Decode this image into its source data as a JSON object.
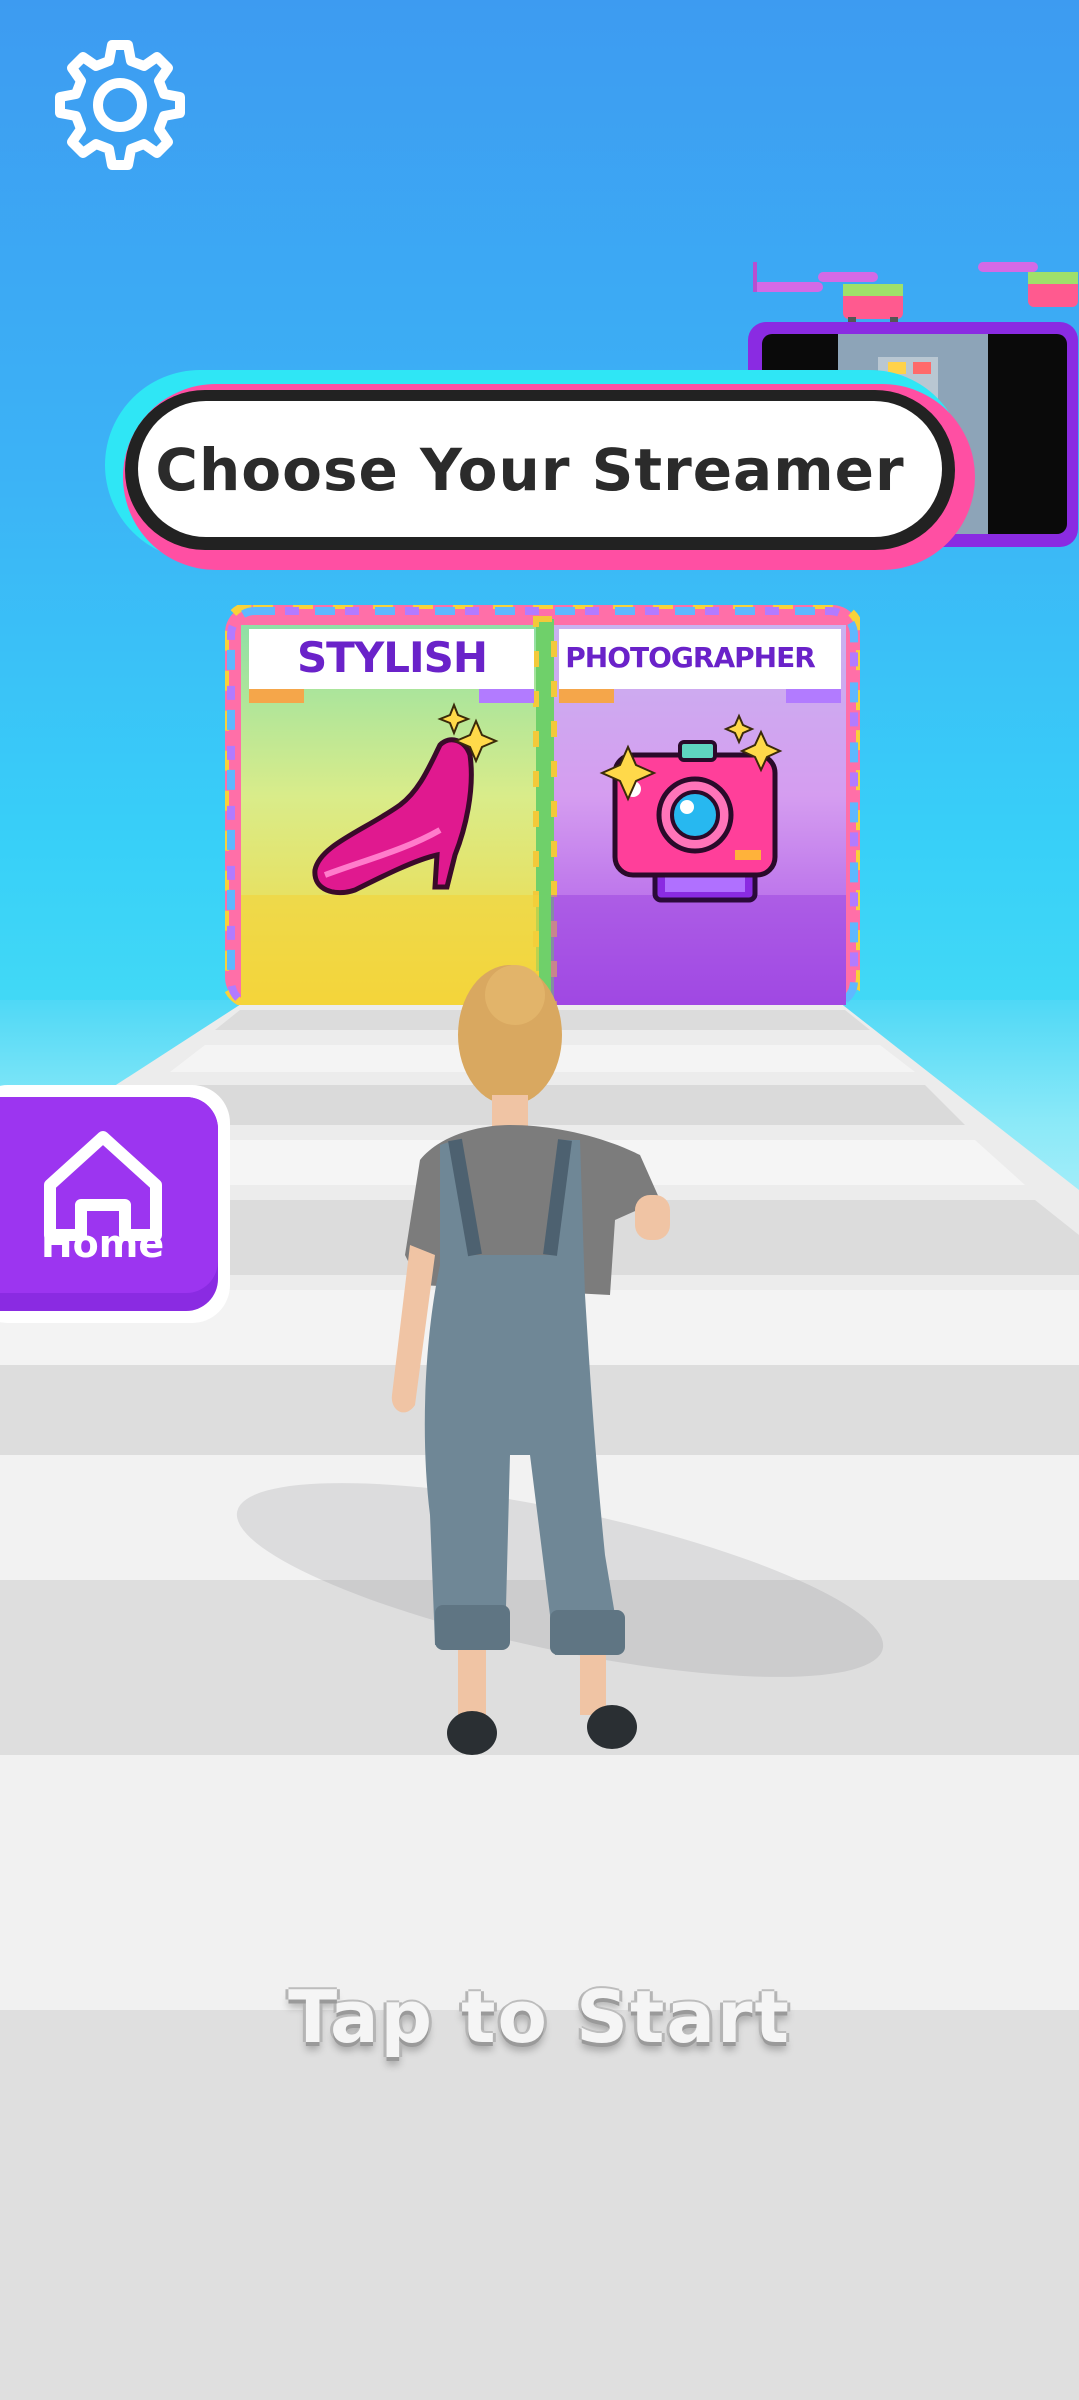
{
  "banner": {
    "title": "Choose Your Streamer"
  },
  "gates": [
    {
      "label": "STYLISH",
      "icon": "high-heel-icon"
    },
    {
      "label": "PHOTOGRAPHER",
      "icon": "camera-icon"
    }
  ],
  "home_button": {
    "label": "Home",
    "icon": "home-icon"
  },
  "settings_button": {
    "icon": "gear-icon"
  },
  "prompt": {
    "text": "Tap to Start"
  },
  "colors": {
    "sky_top": "#3d9bf1",
    "banner_accent_cyan": "#27e8f4",
    "banner_accent_pink": "#ff4fa3",
    "purple": "#8a2be2",
    "gate_label_text": "#6a22c9",
    "road": "#e9e9e9"
  }
}
